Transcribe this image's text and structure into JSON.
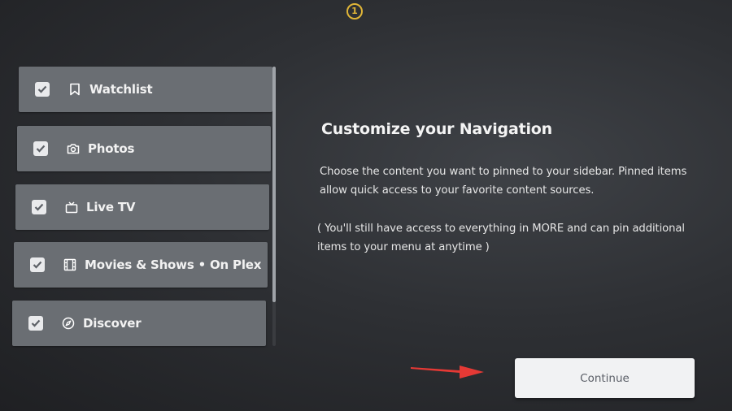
{
  "step_marker": "1",
  "sidebar": {
    "items": [
      {
        "label": "Watchlist",
        "checked": true,
        "icon": "bookmark-icon"
      },
      {
        "label": "Photos",
        "checked": true,
        "icon": "camera-icon"
      },
      {
        "label": "Live TV",
        "checked": true,
        "icon": "tv-icon"
      },
      {
        "label": "Movies & Shows • On Plex",
        "checked": true,
        "icon": "film-icon"
      },
      {
        "label": "Discover",
        "checked": true,
        "icon": "compass-icon"
      }
    ]
  },
  "content": {
    "title": "Customize your Navigation",
    "description": "Choose the content you want to pinned to your sidebar. Pinned items allow quick access to your favorite content sources.",
    "note": "( You'll still have access to everything in MORE and can pin additional items to your menu at anytime )"
  },
  "actions": {
    "continue_label": "Continue"
  },
  "colors": {
    "accent_arrow": "#e53935",
    "step_marker": "#e0b537",
    "item_background": "#6a6e73",
    "button_background": "#f1f2f3"
  }
}
